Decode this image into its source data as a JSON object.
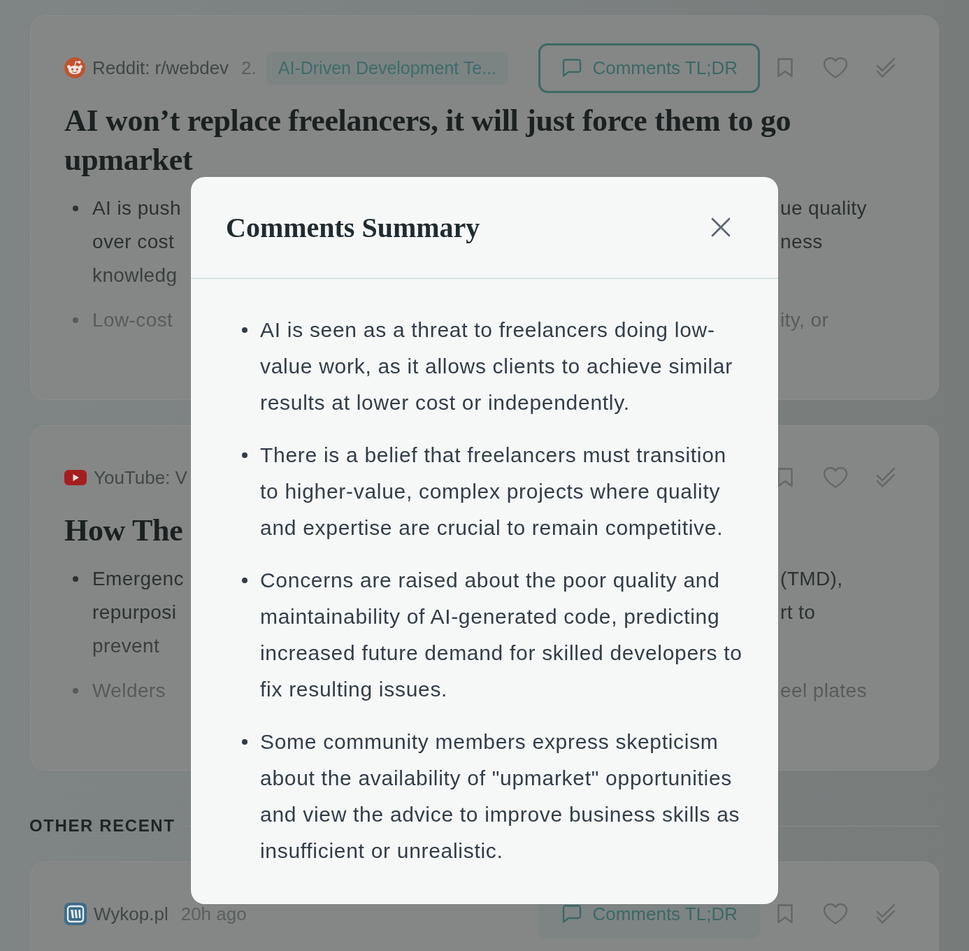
{
  "cards": [
    {
      "source": {
        "kind": "reddit",
        "name": "Reddit: r/webdev"
      },
      "time": "2.",
      "tag": "AI-Driven Development Te...",
      "comments_button": {
        "label": "Comments TL;DR",
        "focused": true
      },
      "title": "AI won’t replace freelancers, it will just force them to go upmarket",
      "summary": [
        {
          "lines": [
            {
              "left": "AI is push",
              "right": "ue quality"
            },
            {
              "left": "over cost",
              "right": "ness"
            },
            {
              "left": "knowledg"
            }
          ]
        },
        {
          "lines": [
            {
              "left": "Low-cost",
              "right": "ity, or"
            }
          ]
        }
      ]
    },
    {
      "source": {
        "kind": "youtube",
        "name": "YouTube: V"
      },
      "title": "How The",
      "summary": [
        {
          "lines": [
            {
              "left": "Emergenc",
              "right": "(TMD),"
            },
            {
              "left": "repurposi",
              "right": "rt to"
            },
            {
              "left": "prevent"
            }
          ]
        },
        {
          "lines": [
            {
              "left": "Welders",
              "right": "eel plates"
            }
          ]
        }
      ]
    }
  ],
  "section_heading": "OTHER RECENT",
  "recent_cards": [
    {
      "source": {
        "kind": "wykop",
        "name": "Wykop.pl"
      },
      "time": "20h ago",
      "comments_button": {
        "label": "Comments TL;DR",
        "focused": false
      }
    }
  ],
  "modal": {
    "title": "Comments Summary",
    "points": [
      "AI is seen as a threat to freelancers doing low-value work, as it allows clients to achieve similar results at lower cost or independently.",
      "There is a belief that freelancers must transition to higher-value, complex projects where quality and expertise are crucial to remain competitive.",
      "Concerns are raised about the poor quality and maintainability of AI-generated code, predicting increased future demand for skilled developers to fix resulting issues.",
      "Some community members express skepticism about the availability of \"upmarket\" opportunities and view the advice to improve business skills as insufficient or unrealistic."
    ]
  }
}
